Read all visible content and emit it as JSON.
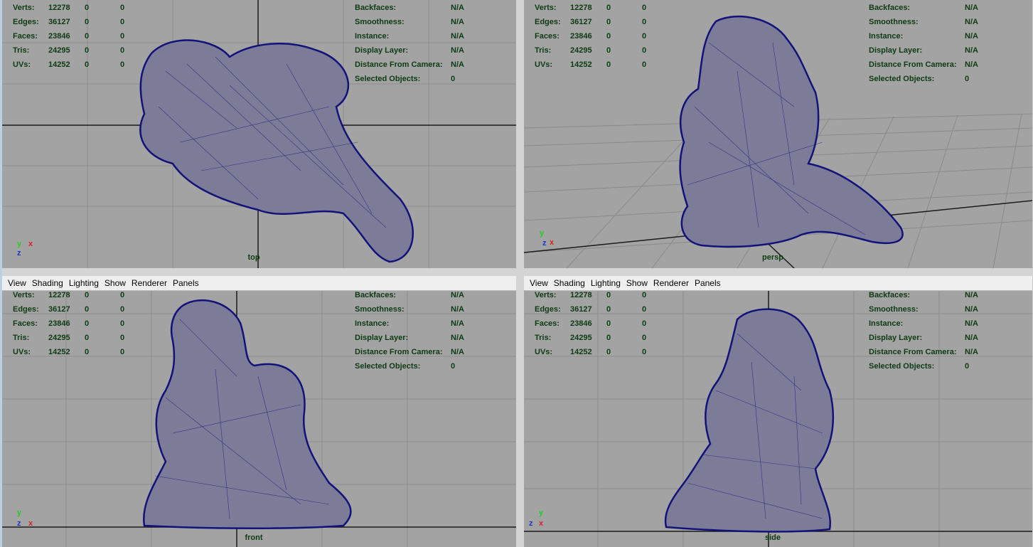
{
  "menu": [
    "View",
    "Shading",
    "Lighting",
    "Show",
    "Renderer",
    "Panels"
  ],
  "hud_stats": [
    {
      "label": "Verts:",
      "v1": "12278",
      "v2": "0",
      "v3": "0"
    },
    {
      "label": "Edges:",
      "v1": "36127",
      "v2": "0",
      "v3": "0"
    },
    {
      "label": "Faces:",
      "v1": "23846",
      "v2": "0",
      "v3": "0"
    },
    {
      "label": "Tris:",
      "v1": "24295",
      "v2": "0",
      "v3": "0"
    },
    {
      "label": "UVs:",
      "v1": "14252",
      "v2": "0",
      "v3": "0"
    }
  ],
  "hud_info": [
    {
      "label": "Backfaces:",
      "value": "N/A"
    },
    {
      "label": "Smoothness:",
      "value": "N/A"
    },
    {
      "label": "Instance:",
      "value": "N/A"
    },
    {
      "label": "Display Layer:",
      "value": "N/A"
    },
    {
      "label": "Distance From Camera:",
      "value": "N/A"
    },
    {
      "label": "Selected Objects:",
      "value": "0"
    }
  ],
  "viewports": {
    "top": {
      "camera": "top"
    },
    "persp": {
      "camera": "persp"
    },
    "front": {
      "camera": "front"
    },
    "side": {
      "camera": "side"
    }
  },
  "axes": {
    "x": "x",
    "y": "y",
    "z": "z"
  },
  "colors": {
    "viewport_bg": "#a3a3a3",
    "grid": "#8a8a8a",
    "mesh": "#12127a",
    "mesh_fill": "#7c7c98",
    "hud_text": "#0d3b12"
  }
}
